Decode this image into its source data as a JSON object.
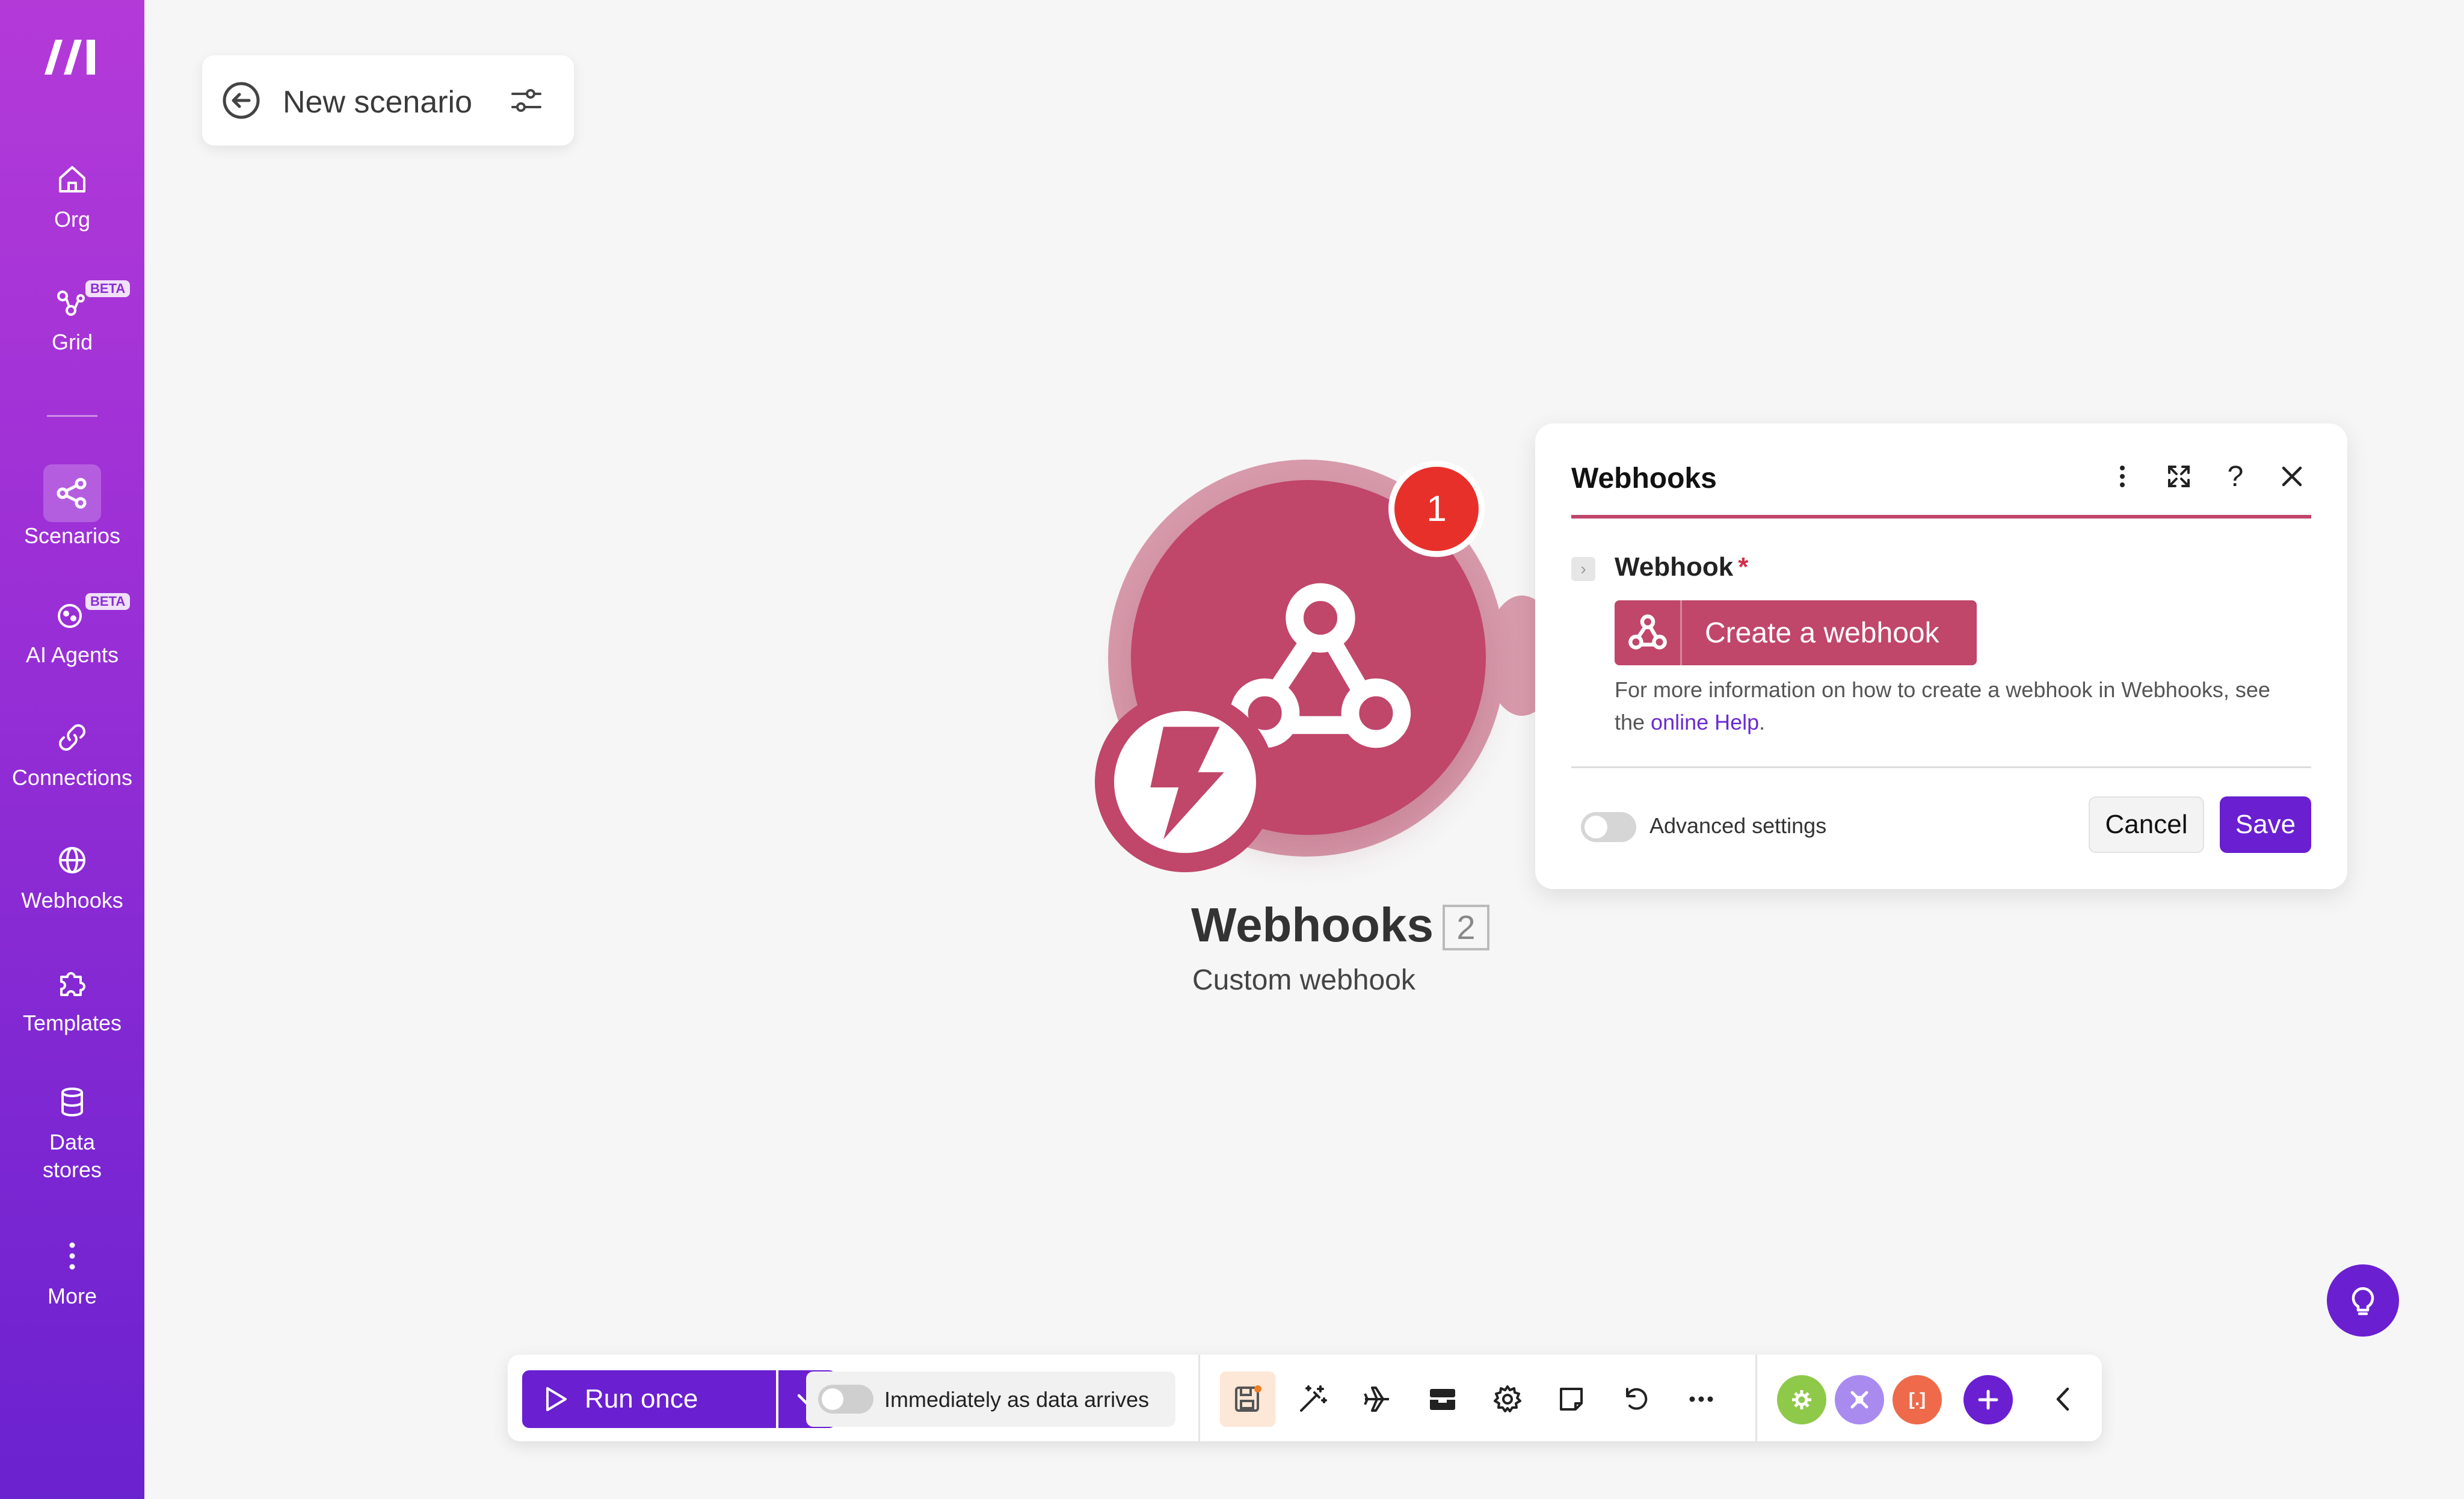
{
  "sidebar": {
    "items": [
      {
        "label": "Org",
        "icon": "home-icon"
      },
      {
        "label": "Grid",
        "icon": "grid-icon",
        "badge": "BETA"
      },
      {
        "label": "Scenarios",
        "icon": "share-icon"
      },
      {
        "label": "AI Agents",
        "icon": "ai-agents-icon",
        "badge": "BETA"
      },
      {
        "label": "Connections",
        "icon": "link-icon"
      },
      {
        "label": "Webhooks",
        "icon": "globe-icon"
      },
      {
        "label": "Templates",
        "icon": "puzzle-icon"
      },
      {
        "label": "Data\nstores",
        "label_line1": "Data",
        "label_line2": "stores",
        "icon": "database-icon"
      },
      {
        "label": "More",
        "icon": "more-vertical-icon"
      }
    ]
  },
  "header": {
    "scenario_name": "New scenario"
  },
  "module": {
    "title": "Webhooks",
    "number": "2",
    "subtitle": "Custom webhook",
    "badge_count": "1",
    "color": "#c0466a"
  },
  "panel": {
    "title": "Webhooks",
    "help_icon_label": "?",
    "field_label": "Webhook",
    "required_mark": "*",
    "create_button": "Create a webhook",
    "help_text_prefix": "For more information on how to create a webhook in Webhooks, see the ",
    "help_link": "online Help",
    "help_text_suffix": ".",
    "advanced_label": "Advanced settings",
    "cancel_label": "Cancel",
    "save_label": "Save"
  },
  "toolbar": {
    "run_label": "Run once",
    "schedule_label": "Immediately as data arrives",
    "app_badge_3": "[.]"
  },
  "colors": {
    "accent": "#6a1fd1",
    "webhook": "#c0466a",
    "badge_red": "#e8302b"
  }
}
